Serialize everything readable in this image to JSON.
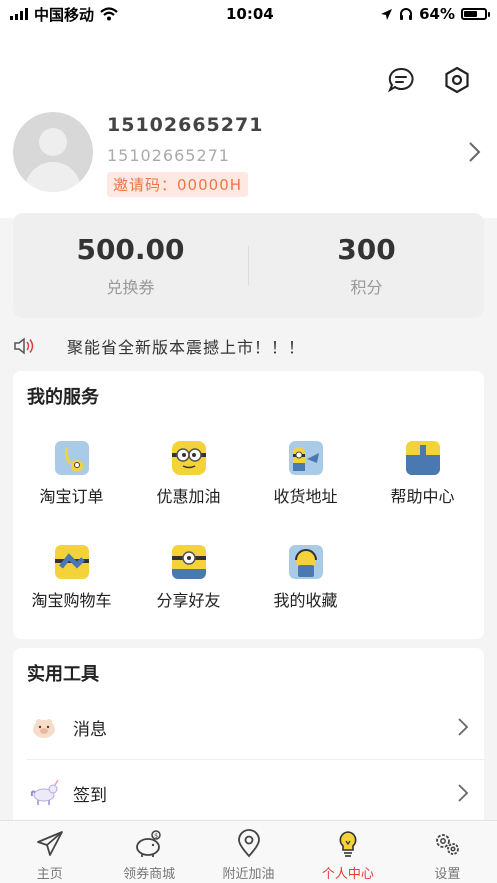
{
  "status_bar": {
    "carrier": "中国移动",
    "time": "10:04",
    "battery": "64%",
    "battery_level": 0.64
  },
  "profile": {
    "name": "15102665271",
    "phone": "15102665271",
    "invite_label": "邀请码：",
    "invite_code": "00000H"
  },
  "stats": [
    {
      "value": "500.00",
      "label": "兑换券"
    },
    {
      "value": "300",
      "label": "积分"
    }
  ],
  "notice": {
    "text": "聚能省全新版本震撼上市！！！"
  },
  "services": {
    "title": "我的服务",
    "items": [
      {
        "label": "淘宝订单",
        "icon": "taobao-order-icon"
      },
      {
        "label": "优惠加油",
        "icon": "discount-fuel-icon"
      },
      {
        "label": "收货地址",
        "icon": "shipping-address-icon"
      },
      {
        "label": "帮助中心",
        "icon": "help-center-icon"
      },
      {
        "label": "淘宝购物车",
        "icon": "taobao-cart-icon"
      },
      {
        "label": "分享好友",
        "icon": "share-friends-icon"
      },
      {
        "label": "我的收藏",
        "icon": "favorites-icon"
      }
    ]
  },
  "tools": {
    "title": "实用工具",
    "items": [
      {
        "label": "消息",
        "icon": "message-pig-icon"
      },
      {
        "label": "签到",
        "icon": "checkin-unicorn-icon"
      }
    ]
  },
  "tabbar": {
    "items": [
      {
        "label": "主页",
        "icon": "paper-plane-icon",
        "active": false
      },
      {
        "label": "领券商城",
        "icon": "piggy-bank-icon",
        "active": false
      },
      {
        "label": "附近加油",
        "icon": "location-pin-icon",
        "active": false
      },
      {
        "label": "个人中心",
        "icon": "lightbulb-icon",
        "active": true
      },
      {
        "label": "设置",
        "icon": "gears-icon",
        "active": false
      }
    ]
  },
  "colors": {
    "accent": "#e23c3c",
    "invite_bg": "#fde9e2",
    "invite_text": "#f07448"
  }
}
